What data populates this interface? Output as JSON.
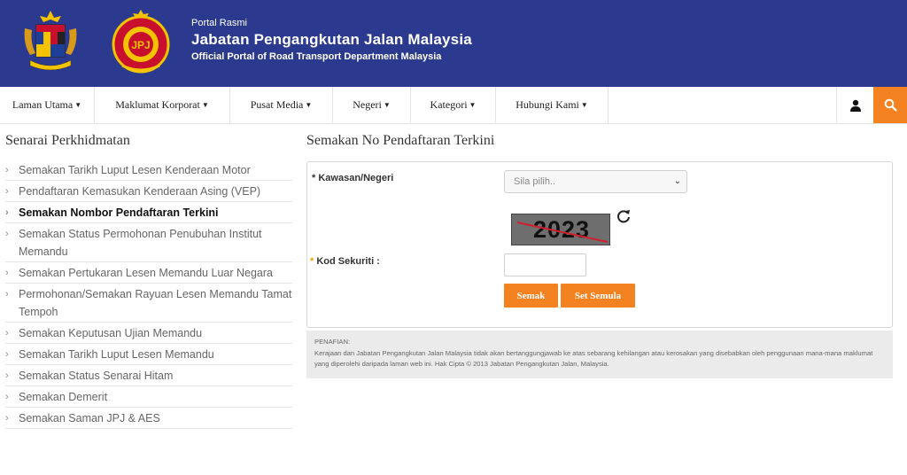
{
  "header": {
    "small": "Portal Rasmi",
    "title": "Jabatan Pengangkutan Jalan Malaysia",
    "subtitle": "Official Portal of Road Transport Department Malaysia"
  },
  "nav": {
    "items": [
      {
        "label": "Laman Utama"
      },
      {
        "label": "Maklumat Korporat"
      },
      {
        "label": "Pusat Media"
      },
      {
        "label": "Negeri"
      },
      {
        "label": "Kategori"
      },
      {
        "label": "Hubungi Kami"
      }
    ],
    "user_icon": "user-icon",
    "search_icon": "search-icon"
  },
  "sidebar": {
    "title": "Senarai Perkhidmatan",
    "items": [
      {
        "label": "Semakan Tarikh Luput Lesen Kenderaan Motor"
      },
      {
        "label": "Pendaftaran Kemasukan Kenderaan Asing (VEP)"
      },
      {
        "label": "Semakan Nombor Pendaftaran Terkini",
        "active": true
      },
      {
        "label": "Semakan Status Permohonan Penubuhan Institut Memandu"
      },
      {
        "label": "Semakan Pertukaran Lesen Memandu Luar Negara"
      },
      {
        "label": "Permohonan/Semakan Rayuan Lesen Memandu Tamat Tempoh"
      },
      {
        "label": "Semakan Keputusan Ujian Memandu"
      },
      {
        "label": "Semakan Tarikh Luput Lesen Memandu"
      },
      {
        "label": "Semakan Status Senarai Hitam"
      },
      {
        "label": "Semakan Demerit"
      },
      {
        "label": "Semakan Saman JPJ & AES"
      }
    ]
  },
  "main": {
    "title": "Semakan No Pendaftaran Terkini",
    "form": {
      "kawasan_label": "Kawasan/Negeri",
      "kawasan_placeholder": "Sila pilih..",
      "captcha_text": "2023",
      "kod_label": "Kod Sekuriti :",
      "kod_value": "",
      "semak_label": "Semak",
      "reset_label": "Set Semula",
      "required_mark": "*"
    },
    "disclaimer": {
      "title": "PENAFIAN:",
      "text": "Kerajaan dan Jabatan Pengangkutan Jalan Malaysia tidak akan bertanggungjawab ke atas sebarang kehilangan atau kerosakan yang disebabkan oleh penggunaan mana-mana maklumat yang diperolehi daripada laman web ini. Hak Cipta © 2013 Jabatan Pengangkutan Jalan, Malaysia."
    }
  },
  "colors": {
    "header_bg": "#2b3a8f",
    "accent": "#f58220"
  }
}
